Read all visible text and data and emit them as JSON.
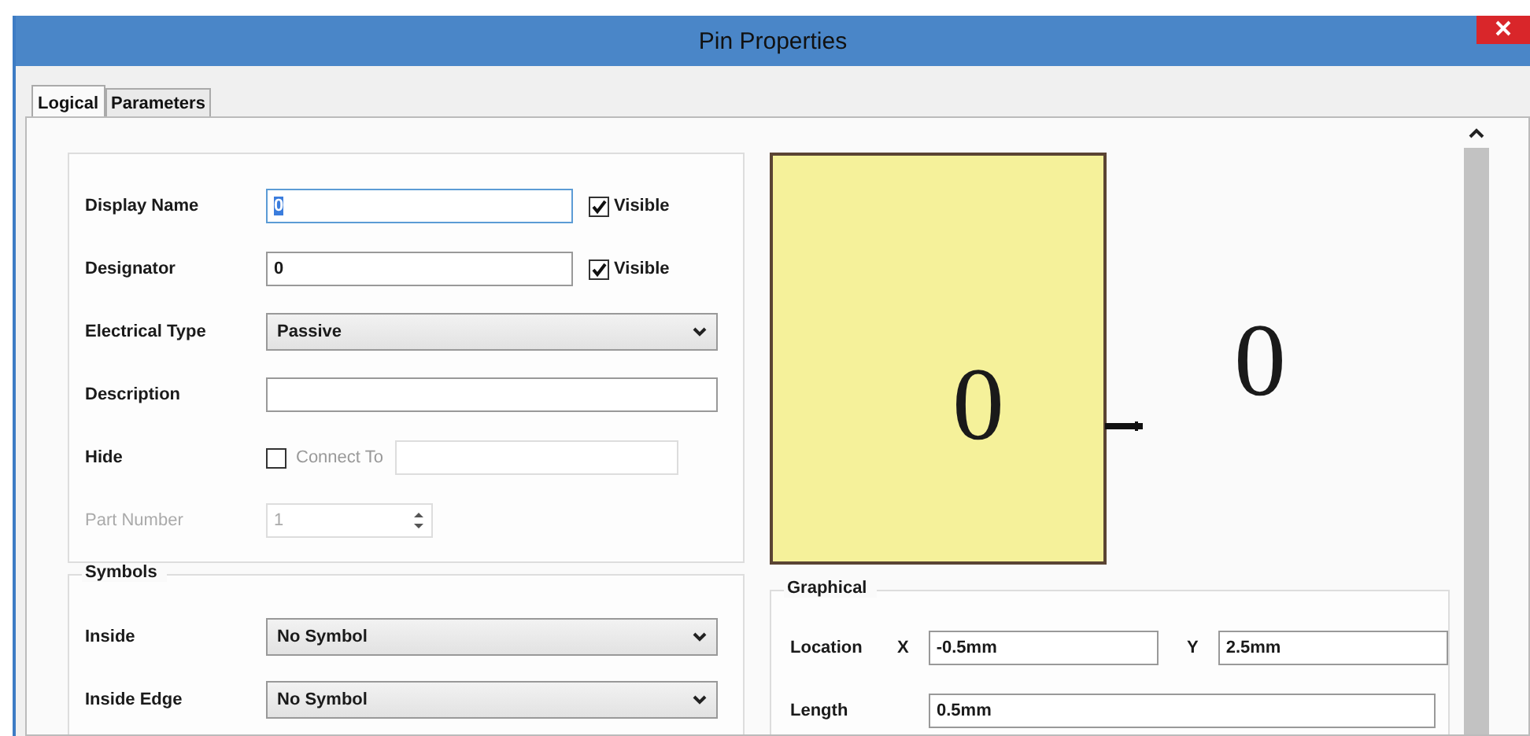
{
  "window": {
    "title": "Pin Properties"
  },
  "tabs": [
    {
      "label": "Logical",
      "selected": true
    },
    {
      "label": "Parameters",
      "selected": false
    }
  ],
  "properties": [
    {
      "kind": "text",
      "label": "Display Name",
      "value": "0",
      "focused": true,
      "visible_label": "Visible",
      "visible": true
    },
    {
      "kind": "text",
      "label": "Designator",
      "value": "0",
      "focused": false,
      "visible_label": "Visible",
      "visible": true
    },
    {
      "kind": "select",
      "label": "Electrical Type",
      "value": "Passive"
    },
    {
      "kind": "text",
      "label": "Description",
      "focused": false
    },
    {
      "kind": "check",
      "label": "Hide",
      "checked": false,
      "check_label": "Connect To",
      "disabled": true
    },
    {
      "kind": "spinner",
      "label": "Part Number",
      "value": "1",
      "disabled": true
    }
  ],
  "symbols": {
    "title": "Symbols",
    "rows": [
      {
        "label": "Inside",
        "value": "No Symbol"
      },
      {
        "label": "Inside Edge",
        "value": "No Symbol"
      }
    ]
  },
  "preview": {
    "name_text": "0",
    "designator_text": "0"
  },
  "graphical": {
    "title": "Graphical",
    "location_label": "Location",
    "x_label": "X",
    "x": "-0.5mm",
    "y_label": "Y",
    "y": "2.5mm",
    "length_label": "Length",
    "length": "0.5mm"
  }
}
